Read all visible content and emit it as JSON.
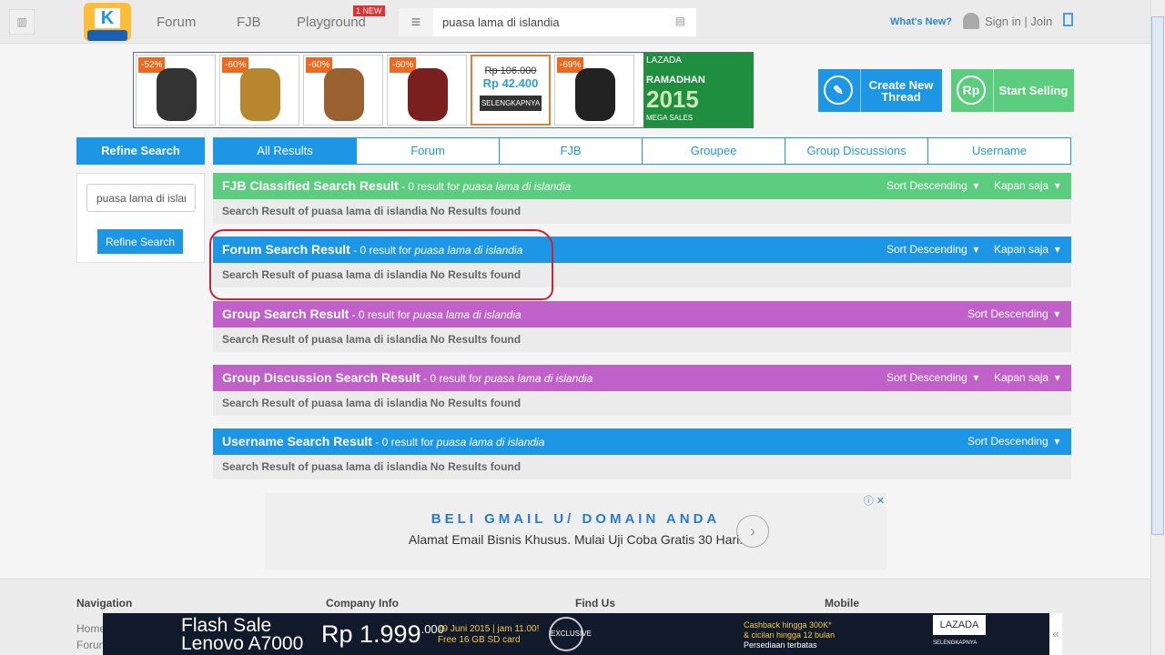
{
  "header": {
    "nav": [
      "Forum",
      "FJB",
      "Playground"
    ],
    "new_badge": "1 NEW",
    "search_value": "puasa lama di islandia",
    "whats_new": "What's New?",
    "signin": "Sign in | Join",
    "logo_letter": "K"
  },
  "ad_banner": {
    "discounts": [
      "-52%",
      "-60%",
      "-60%",
      "-60%",
      "-69%"
    ],
    "old_price": "Rp 106.000",
    "new_price": "Rp 42.400",
    "cta": "SELENGKAPNYA",
    "lazada": "LAZADA",
    "lazada_title": "RAMADHAN",
    "lazada_year": "2015",
    "lazada_sub": "MEGA SALES"
  },
  "actions": {
    "create_thread": "Create New Thread",
    "start_selling": "Start Selling",
    "rp_icon": "Rp"
  },
  "refine": {
    "title": "Refine Search",
    "input_value": "puasa lama di islandia",
    "button": "Refine Search"
  },
  "tabs": [
    "All Results",
    "Forum",
    "FJB",
    "Groupee",
    "Group Discussions",
    "Username"
  ],
  "sections": [
    {
      "title": "FJB Classified Search Result",
      "count": " - 0 result for ",
      "query": "puasa lama di islandia",
      "sort": "Sort Descending",
      "time": "Kapan saja",
      "body": "Search Result of puasa lama di islandia No Results found",
      "color": "#5ccd7e"
    },
    {
      "title": "Forum Search Result",
      "count": " - 0 result for ",
      "query": "puasa lama di islandia",
      "sort": "Sort Descending",
      "time": "Kapan saja",
      "body": "Search Result of puasa lama di islandia No Results found",
      "color": "#1e96e6"
    },
    {
      "title": "Group Search Result",
      "count": " - 0 result for ",
      "query": "puasa lama di islandia",
      "sort": "Sort Descending",
      "body": "Search Result of puasa lama di islandia No Results found",
      "color": "#c061c9"
    },
    {
      "title": "Group Discussion Search Result",
      "count": " - 0 result for ",
      "query": "puasa lama di islandia",
      "sort": "Sort Descending",
      "time": "Kapan saja",
      "body": "Search Result of puasa lama di islandia No Results found",
      "color": "#c061c9"
    },
    {
      "title": "Username Search Result",
      "count": " - 0 result for ",
      "query": "puasa lama di islandia",
      "sort": "Sort Descending",
      "body": "Search Result of puasa lama di islandia No Results found",
      "color": "#1e96e6"
    }
  ],
  "google_ad": {
    "title": "BELI GMAIL U/ DOMAIN ANDA",
    "subtitle": "Alamat Email Bisnis Khusus. Mulai Uji Coba Gratis 30 Hari."
  },
  "footer": {
    "columns": [
      "Navigation",
      "Company Info",
      "Find Us",
      "Mobile"
    ],
    "links": [
      "Home",
      "Forum"
    ]
  },
  "flash_ad": {
    "line1": "Flash Sale",
    "line2": "Lenovo A7000",
    "price": "Rp 1.999",
    "price_sup": ".000",
    "date": "19 Juni 2015 | jam 11.00!",
    "gift": "Free 16 GB SD card",
    "exclusive": "EXCLUSIVE",
    "cashback": "Cashback hingga 300K*",
    "cicilan": "& cicilan hingga 12 bulan",
    "stock": "Persediaan terbatas",
    "brand": "LAZADA",
    "cta": "SELENGKAPNYA"
  }
}
